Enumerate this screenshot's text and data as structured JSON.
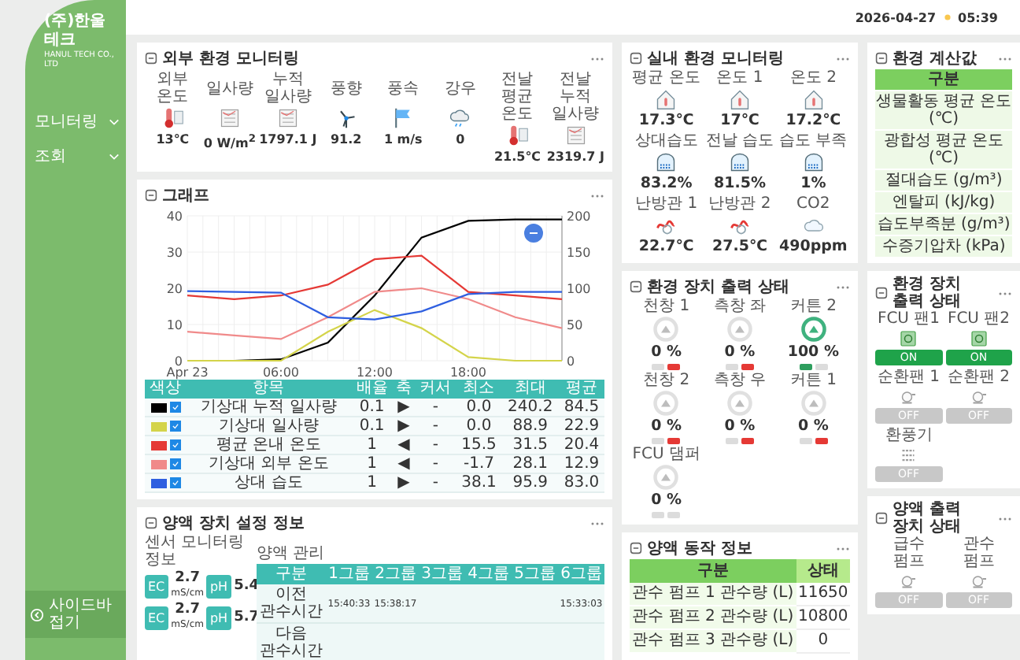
{
  "sidebar": {
    "company": "(주)한울테크",
    "company_sub": "HANUL TECH CO., LTD",
    "menu": [
      "모니터링",
      "조회"
    ],
    "collapse": "사이드바 접기"
  },
  "top_bar": {
    "date": "2026-04-27",
    "time": "05:39"
  },
  "outdoor": {
    "title": "외부 환경 모니터링",
    "items": [
      {
        "kind": "thermometer",
        "label": "외부 온도",
        "value": "13℃"
      },
      {
        "kind": "sheet",
        "label": "일사량",
        "value": "0 W/m$^{2}$"
      },
      {
        "kind": "sheet",
        "label": "누적 일사량",
        "value": "1797.1 J"
      },
      {
        "kind": "windmill",
        "label": "풍향",
        "value": "91.2"
      },
      {
        "kind": "flag",
        "label": "풍속",
        "value": "1 m/s"
      },
      {
        "kind": "cloud",
        "label": "강우",
        "value": "0"
      },
      {
        "kind": "thermometer",
        "label": "전날 평균 온도",
        "value": "21.5℃"
      },
      {
        "kind": "sheet",
        "label": "전날 누적 일사량",
        "value": "2319.7 J"
      }
    ]
  },
  "indoor": {
    "title": "실내 환경 모니터링",
    "items": [
      {
        "kind": "house",
        "label": "평균 온도",
        "value": "17.3℃"
      },
      {
        "kind": "house",
        "label": "온도 1",
        "value": "17℃"
      },
      {
        "kind": "house",
        "label": "온도 2",
        "value": "17.2℃"
      },
      {
        "kind": "greenhouse",
        "label": "상대습도",
        "value": "83.2%"
      },
      {
        "kind": "greenhouse",
        "label": "전날 습도",
        "value": "81.5%"
      },
      {
        "kind": "greenhouse",
        "label": "습도 부족",
        "value": "1%"
      },
      {
        "kind": "pipe",
        "label": "난방관 1",
        "value": "22.7℃"
      },
      {
        "kind": "pipe",
        "label": "난방관 2",
        "value": "27.5℃"
      },
      {
        "kind": "co2",
        "label": "CO2",
        "value": "490ppm"
      }
    ]
  },
  "env_calc": {
    "title": "환경 계산값",
    "header": "구분",
    "rows": [
      "생물활동 평균 온도 (℃)",
      "광합성 평균 온도 (℃)",
      "절대습도 (g/m³)",
      "엔탈피 (kJ/kg)",
      "습도부족분 (g/m³)",
      "수증기압차 (kPa)"
    ]
  },
  "graph": {
    "title": "그래프",
    "chart_data": {
      "type": "line",
      "grid": true,
      "xlim": [
        0,
        24
      ],
      "x": [
        0,
        3,
        6,
        9,
        12,
        15,
        18,
        21,
        24
      ],
      "xticks": [
        {
          "value": 0,
          "label": "Apr 23"
        },
        {
          "value": 6,
          "label": "06:00"
        },
        {
          "value": 12,
          "label": "12:00"
        },
        {
          "value": 18,
          "label": "18:00"
        }
      ],
      "ylim": [
        0,
        40
      ],
      "yticks": [
        0,
        10,
        20,
        30,
        40
      ],
      "series": [
        {
          "name": "기상대 누적 일사량",
          "color": "#000000",
          "values": [
            0,
            0,
            0.4,
            5,
            18,
            34,
            38.6,
            39,
            39
          ]
        },
        {
          "name": "기상대 일사량",
          "color": "#d4d44a",
          "values": [
            0,
            0,
            0,
            8,
            14,
            9,
            1,
            0,
            0
          ]
        },
        {
          "name": "평균 온내 온도",
          "color": "#e53935",
          "values": [
            18,
            17,
            18,
            21,
            28,
            29,
            19,
            18,
            17
          ]
        },
        {
          "name": "기상대 외부 온도",
          "color": "#f08a8a",
          "values": [
            8,
            7,
            6,
            12,
            19,
            20,
            17,
            12,
            9
          ]
        },
        {
          "name": "상대 습도",
          "color": "#2f5fe0",
          "values": [
            19.2,
            19,
            18.8,
            12,
            11.4,
            13.6,
            18.4,
            19,
            19
          ]
        }
      ]
    },
    "right_axis_labels": [
      "200",
      "150",
      "100",
      "50",
      "0"
    ],
    "legend": {
      "columns": [
        "색상",
        "항목",
        "배율",
        "축",
        "커서",
        "최소",
        "최대",
        "평균"
      ],
      "rows": [
        {
          "visible": true,
          "scale": "0.1",
          "axis": "▶",
          "cursor": "-",
          "min": "0.0",
          "max": "240.2",
          "avg": "84.5"
        },
        {
          "visible": true,
          "scale": "0.1",
          "axis": "▶",
          "cursor": "-",
          "min": "0.0",
          "max": "88.9",
          "avg": "22.9"
        },
        {
          "visible": true,
          "scale": "1",
          "axis": "◀",
          "cursor": "-",
          "min": "15.5",
          "max": "31.5",
          "avg": "20.4"
        },
        {
          "visible": true,
          "scale": "1",
          "axis": "◀",
          "cursor": "-",
          "min": "-1.7",
          "max": "28.1",
          "avg": "12.9"
        },
        {
          "visible": true,
          "scale": "1",
          "axis": "▶",
          "cursor": "-",
          "min": "38.1",
          "max": "95.9",
          "avg": "83.0"
        }
      ]
    }
  },
  "devices": {
    "title": "환경 장치 출력 상태",
    "items": [
      {
        "label": "천창 1",
        "level": 0,
        "reading": "0 %",
        "on_lamp": false,
        "off_lamp": true
      },
      {
        "label": "측창 좌",
        "level": 0,
        "reading": "0 %",
        "on_lamp": false,
        "off_lamp": true
      },
      {
        "label": "커튼 2",
        "level": 1,
        "reading": "100 %",
        "on_lamp": true,
        "off_lamp": false
      },
      {
        "label": "천창 2",
        "level": 0,
        "reading": "0 %",
        "on_lamp": false,
        "off_lamp": true
      },
      {
        "label": "측창 우",
        "level": 0,
        "reading": "0 %",
        "on_lamp": false,
        "off_lamp": true
      },
      {
        "label": "커튼 1",
        "level": 0,
        "reading": "0 %",
        "on_lamp": false,
        "off_lamp": true
      },
      {
        "label": "FCU 댐퍼",
        "level": 0,
        "reading": "0 %",
        "on_lamp": false,
        "off_lamp": false
      }
    ]
  },
  "hvac": {
    "title": "환경 장치 출력 상태",
    "items": [
      {
        "kind": "fan",
        "label": "FCU 팬1",
        "on": true,
        "button": "ON"
      },
      {
        "kind": "fan",
        "label": "FCU 팬2",
        "on": true,
        "button": "ON"
      },
      {
        "kind": "pump",
        "label": "순환팬 1",
        "on": false,
        "button": "OFF"
      },
      {
        "kind": "pump",
        "label": "순환팬 2",
        "on": false,
        "button": "OFF"
      },
      {
        "kind": "heater",
        "label": "환풍기",
        "on": false,
        "button": "OFF"
      }
    ]
  },
  "nutrient_settings": {
    "title": "양액 장치 설정 정보",
    "sensors_title": "센서 모니터링 정보",
    "sensors": [
      {
        "ec_label": "EC",
        "ec": "2.7",
        "unit": "mS/cm",
        "ph_label": "pH",
        "ph": "5.4"
      },
      {
        "ec_label": "EC",
        "ec": "2.7",
        "unit": "mS/cm",
        "ph_label": "pH",
        "ph": "5.7"
      }
    ],
    "management_title": "양액 관리",
    "columns": [
      "구분",
      "1그룹",
      "2그룹",
      "3그룹",
      "4그룹",
      "5그룹",
      "6그룹"
    ],
    "rows": [
      {
        "cells": [
          "이전 관수시간",
          "15:40:33",
          "15:38:17",
          null,
          null,
          null,
          "15:33:03"
        ]
      },
      {
        "cells": [
          "다음 관수시간",
          null,
          null,
          null,
          null,
          null,
          null
        ]
      }
    ]
  },
  "nutrient_action": {
    "title": "양액 동작 정보",
    "columns": [
      "구분",
      "상태"
    ],
    "rows": [
      {
        "label": "관수 펌프 1 관수량 (L)",
        "value": "11650"
      },
      {
        "label": "관수 펌프 2 관수량 (L)",
        "value": "10800"
      },
      {
        "label": "관수 펌프 3 관수량 (L)",
        "value": "0"
      }
    ]
  },
  "nutrient_output": {
    "title": "양액 출력 장치 상태",
    "items": [
      {
        "kind": "pump",
        "label": "급수 펌프",
        "on": false,
        "button": "OFF"
      },
      {
        "kind": "pump",
        "label": "관수 펌프",
        "on": false,
        "button": "OFF"
      }
    ]
  }
}
